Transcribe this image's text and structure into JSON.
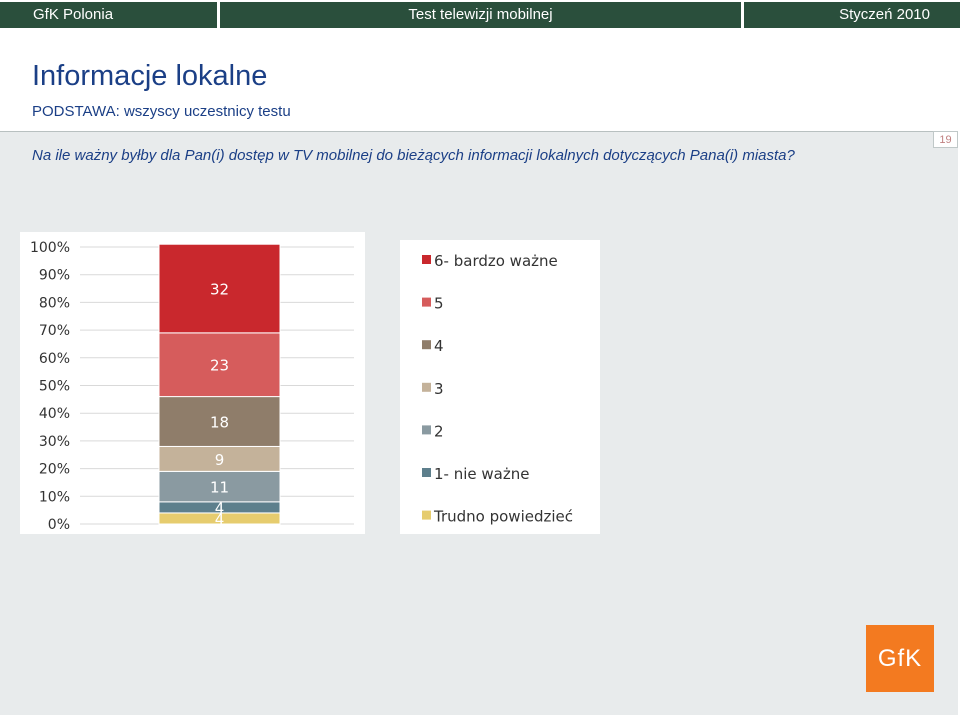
{
  "header": {
    "left_label": "GfK Polonia",
    "center_label": "Test telewizji mobilnej",
    "right_label": "Styczeń 2010"
  },
  "page": {
    "title": "Informacje lokalne",
    "subtitle": "PODSTAWA: wszyscy uczestnicy testu",
    "question": "Na ile ważny byłby dla Pan(i) dostęp w TV mobilnej do bieżących informacji lokalnych dotyczących Pana(i)  miasta?",
    "page_number": "19",
    "logo_text": "GfK"
  },
  "colors": {
    "header_bg": "#2a4f3c",
    "text_blue": "#1b3f86",
    "logo_orange": "#f37a20"
  },
  "chart_data": {
    "type": "bar",
    "stacked": true,
    "ylim": [
      0,
      100
    ],
    "y_ticks": [
      "0%",
      "10%",
      "20%",
      "30%",
      "40%",
      "50%",
      "60%",
      "70%",
      "80%",
      "90%",
      "100%"
    ],
    "grid": true,
    "legend_position": "right",
    "series": [
      {
        "name": "Trudno powiedzieć",
        "value": 4,
        "label": "4",
        "color": "#e6cc6e"
      },
      {
        "name": "1- nie ważne",
        "value": 4,
        "label": "4",
        "color": "#5d7f8c"
      },
      {
        "name": "2",
        "value": 11,
        "label": "11",
        "color": "#8a9aa1"
      },
      {
        "name": "3",
        "value": 9,
        "label": "9",
        "color": "#c4b29a"
      },
      {
        "name": "4",
        "value": 18,
        "label": "18",
        "color": "#8f7d6a"
      },
      {
        "name": "5",
        "value": 23,
        "label": "23",
        "color": "#d65c5c"
      },
      {
        "name": "6- bardzo ważne",
        "value": 32,
        "label": "32",
        "color": "#c9282d"
      }
    ],
    "legend_order": [
      "6- bardzo ważne",
      "5",
      "4",
      "3",
      "2",
      "1- nie ważne",
      "Trudno powiedzieć"
    ]
  }
}
